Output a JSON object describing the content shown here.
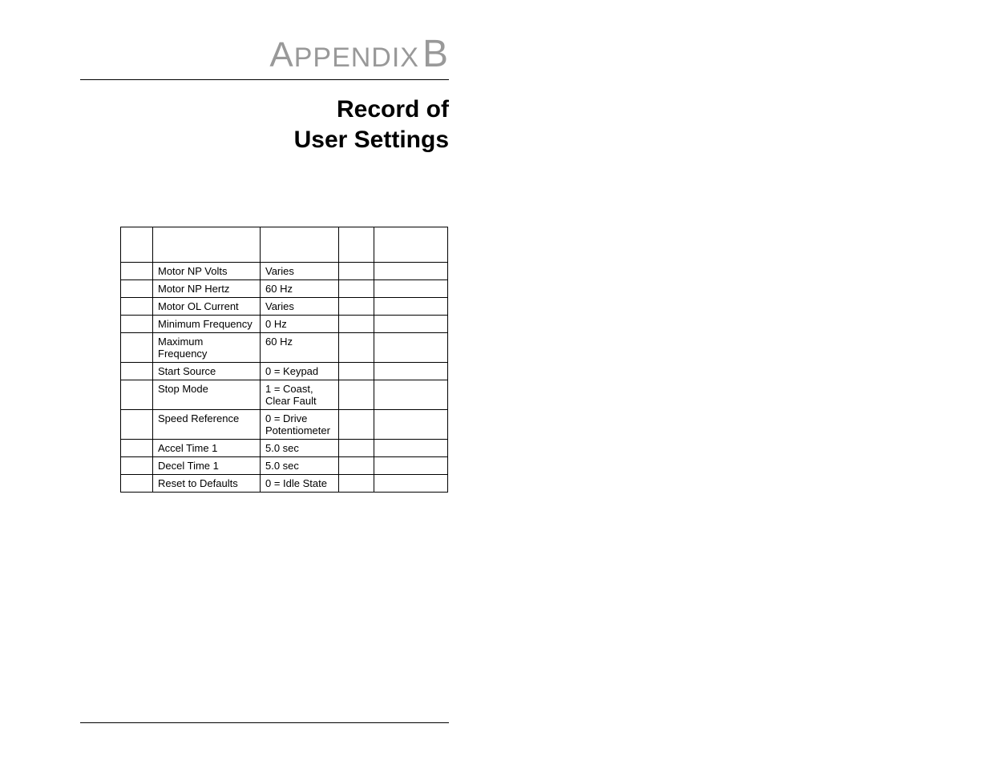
{
  "header": {
    "appendix_prefix_first": "A",
    "appendix_prefix_rest": "PPENDIX",
    "appendix_letter": "B",
    "subtitle_line1": "Record of",
    "subtitle_line2": "User Settings"
  },
  "table": {
    "rows": [
      {
        "name": "Motor NP Volts",
        "default": "Varies"
      },
      {
        "name": "Motor NP Hertz",
        "default": "60 Hz"
      },
      {
        "name": "Motor OL Current",
        "default": "Varies"
      },
      {
        "name": "Minimum Frequency",
        "default": "0 Hz"
      },
      {
        "name": "Maximum Frequency",
        "default": "60 Hz"
      },
      {
        "name": "Start Source",
        "default": "0 = Keypad"
      },
      {
        "name": "Stop Mode",
        "default": "1 = Coast,\nClear Fault"
      },
      {
        "name": "Speed Reference",
        "default": "0 = Drive\nPotentiometer"
      },
      {
        "name": "Accel Time 1",
        "default": "5.0 sec"
      },
      {
        "name": "Decel Time 1",
        "default": "5.0 sec"
      },
      {
        "name": "Reset to Defaults",
        "default": "0 = Idle State"
      }
    ]
  }
}
